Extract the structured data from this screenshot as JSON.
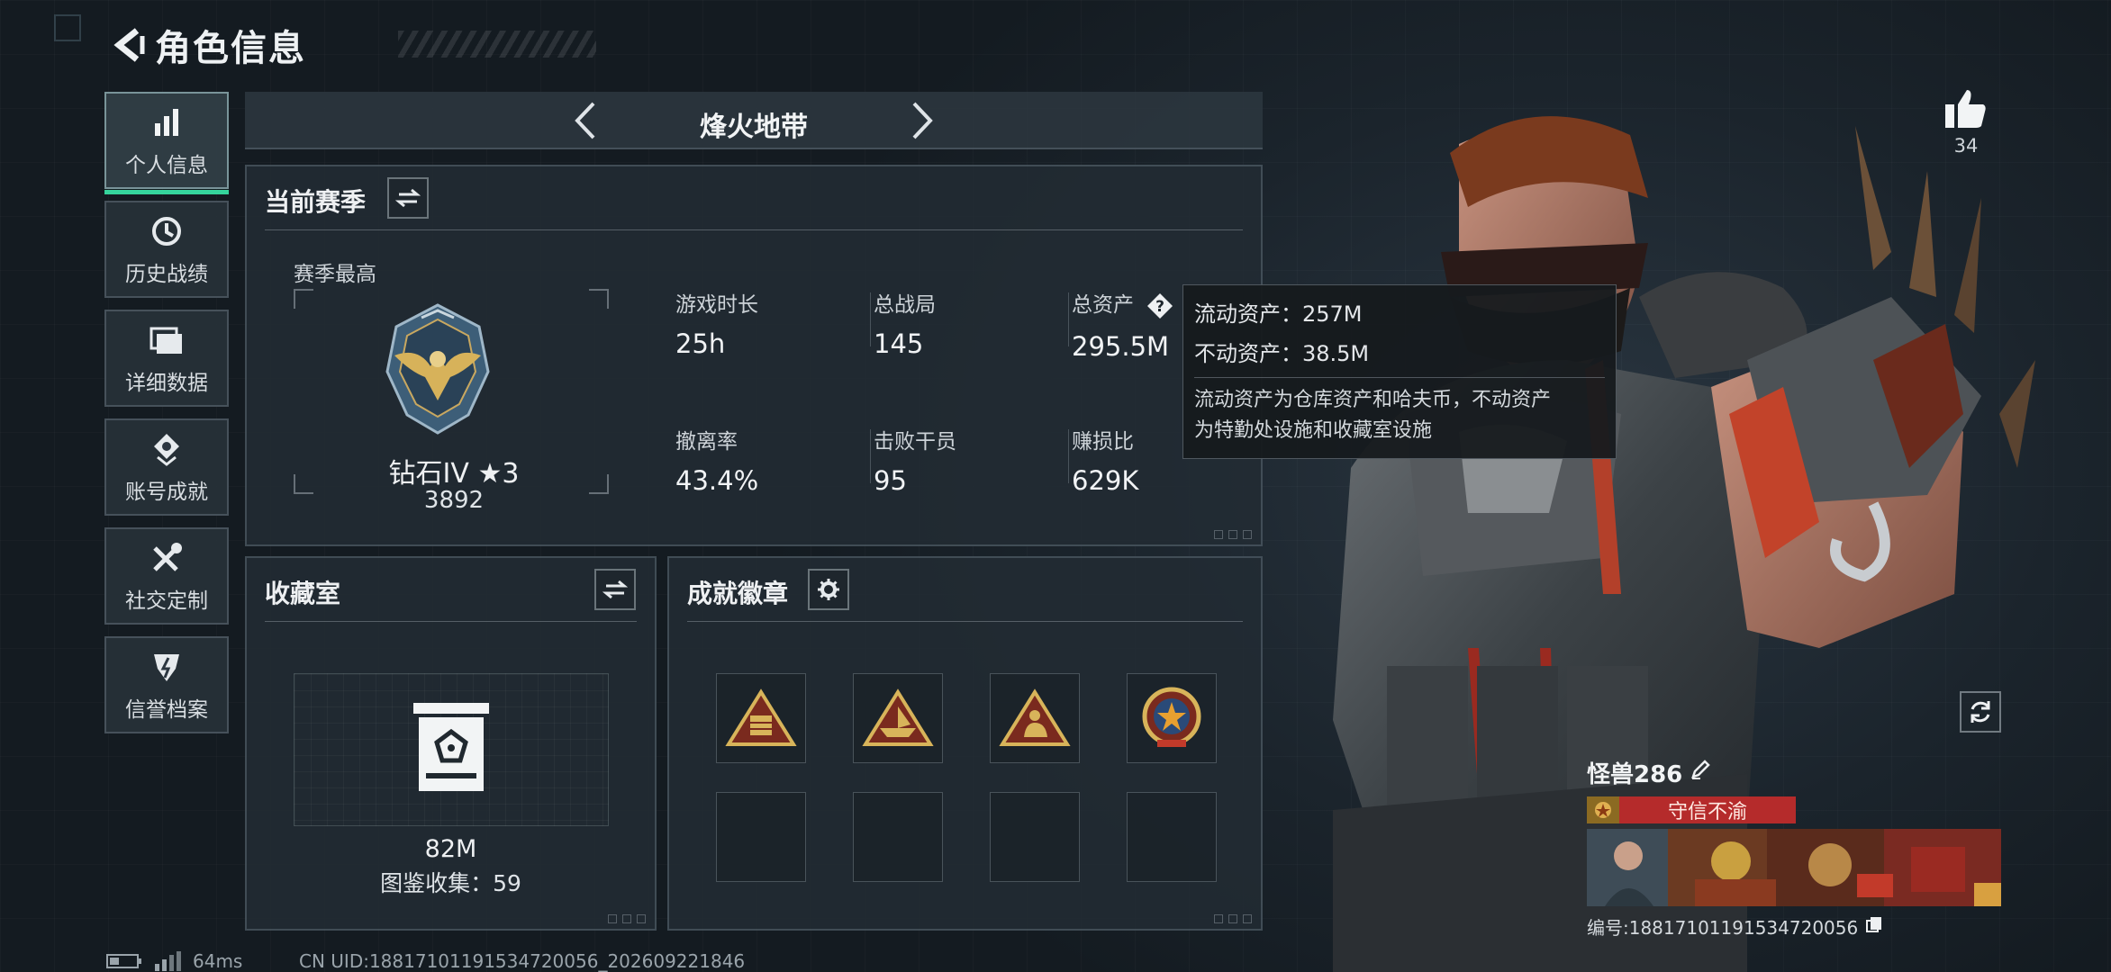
{
  "header": {
    "title": "角色信息"
  },
  "sidebar": {
    "items": [
      {
        "label": "个人信息",
        "icon": "bar-chart-icon",
        "active": true
      },
      {
        "label": "历史战绩",
        "icon": "history-clock-icon",
        "active": false
      },
      {
        "label": "详细数据",
        "icon": "folder-icon",
        "active": false
      },
      {
        "label": "账号成就",
        "icon": "achievement-icon",
        "active": false
      },
      {
        "label": "社交定制",
        "icon": "tools-icon",
        "active": false
      },
      {
        "label": "信誉档案",
        "icon": "credit-shield-icon",
        "active": false
      }
    ]
  },
  "mode": {
    "title": "烽火地带"
  },
  "season": {
    "title": "当前赛季",
    "best_label": "赛季最高",
    "rank_name": "钻石IV ★3",
    "rank_score": "3892",
    "stats": [
      {
        "label": "游戏时长",
        "value": "25h"
      },
      {
        "label": "总战局",
        "value": "145"
      },
      {
        "label": "总资产",
        "value": "295.5M"
      },
      {
        "label": "撤离率",
        "value": "43.4%"
      },
      {
        "label": "击败干员",
        "value": "95"
      },
      {
        "label": "赚损比",
        "value": "629K"
      }
    ]
  },
  "collection": {
    "title": "收藏室",
    "value": "82M",
    "count": "图鉴收集：59"
  },
  "badges": {
    "title": "成就徽章",
    "slots": [
      "badge-crate-icon",
      "badge-boat-icon",
      "badge-figure-icon",
      "badge-star-medal-icon",
      "",
      "",
      "",
      ""
    ]
  },
  "tooltip": {
    "liquid": "流动资产：257M",
    "fixed": "不动资产：38.5M",
    "desc_1": "流动资产为仓库资产和哈夫币，不动资产",
    "desc_2": "为特勤处设施和收藏室设施"
  },
  "like": {
    "count": "34"
  },
  "player": {
    "name": "怪兽286",
    "title": "守信不渝",
    "id": "编号:1881710119153472​0056"
  },
  "status": {
    "ping": "64ms",
    "uid": "CN UID:1881710119153472​0056_202609221846"
  },
  "colors": {
    "accent": "#35d49c",
    "title_badge": "#b52b2b"
  }
}
